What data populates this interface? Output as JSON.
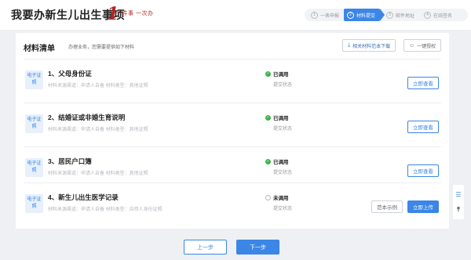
{
  "header": {
    "title": "我要办新生儿出生事项",
    "logo_text": "一件事 一次办",
    "steps": [
      {
        "num": "1",
        "label": "一表申报"
      },
      {
        "num": "2",
        "label": "材料提交"
      },
      {
        "num": "3",
        "label": "邮件地址"
      },
      {
        "num": "4",
        "label": "在线签名"
      }
    ]
  },
  "card": {
    "title": "材料清单",
    "subtitle": "办理业务，您需要提供如下材料",
    "download_label": "相关材料范本下载",
    "auth_label": "一键授权"
  },
  "items": [
    {
      "tag": "电子证照",
      "name": "1、父母身份证",
      "meta": "材料来源渠道：申请人自备  材料类型：其他证照",
      "status": "已调用",
      "status_label": "提交状态",
      "action": "立即查看"
    },
    {
      "tag": "电子证照",
      "name": "2、结婚证或非婚生育说明",
      "meta": "材料来源渠道：申请人自备  材料类型：其他证照",
      "status": "已调用",
      "status_label": "提交状态",
      "action": "立即查看"
    },
    {
      "tag": "电子证照",
      "name": "3、居民户口簿",
      "meta": "材料来源渠道：申请人自备  材料类型：其他证照",
      "status": "已调用",
      "status_label": "提交状态",
      "action": "立即查看"
    },
    {
      "tag": "电子证照",
      "name": "4、新生儿出生医学记录",
      "meta": "材料来源渠道：申请人自备  材料类型：自然人身份证照",
      "status": "未调用",
      "status_label": "提交状态",
      "sample": "范本示例",
      "action": "立即上传"
    }
  ],
  "nav": {
    "prev": "上一步",
    "next": "下一步"
  },
  "colors": {
    "accent": "#3b86e6",
    "success": "#3bb54a",
    "logo": "#b3231f"
  }
}
